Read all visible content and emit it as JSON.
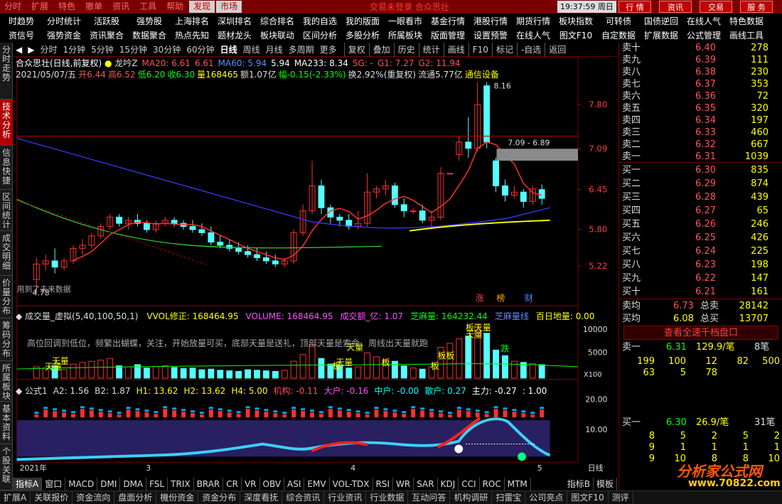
{
  "top_tabs": [
    "分时",
    "扩展",
    "特色",
    "撤单",
    "资讯",
    "工具",
    "帮助",
    "发现",
    "市场"
  ],
  "top_center": "交易未登录 合众思壮",
  "clock": "19:37:59 周日",
  "top_buttons": [
    "行 情",
    "资讯",
    "交易",
    "服 务"
  ],
  "menu_row1": [
    "时趋势",
    "分时统计",
    "活跃股",
    "强势股",
    "上海排名",
    "深圳排名",
    "综合排名",
    "我的自选",
    "我的版面",
    "一眼看市",
    "基金行情",
    "港股行情",
    "期货行情",
    "板块指数",
    "可转债",
    "国债逆回",
    "在线人气",
    "特色数据"
  ],
  "menu_row2": [
    "资信号",
    "强势资金",
    "资讯聚合",
    "数据聚合",
    "热点先知",
    "题材龙头",
    "板块联动",
    "区间分析",
    "多股分析",
    "所属板块",
    "版面管理",
    "设置预警",
    "在线人气",
    "图文F10",
    "自定数据",
    "扩展数据",
    "公式管理",
    "画线工具"
  ],
  "left_nav": [
    "分时走势",
    "技术分析",
    "信息快捷",
    "区间统计",
    "成交明细",
    "价量分布",
    "筹码分布",
    "所属板块",
    "基本资料",
    "个股关联"
  ],
  "periods": [
    "分时",
    "1分钟",
    "5分钟",
    "15分钟",
    "30分钟",
    "60分钟",
    "日线",
    "周线",
    "月线",
    "多周期",
    "更多"
  ],
  "period_active": "日线",
  "right_tools": [
    "复权",
    "叠加",
    "历史",
    "统计",
    "画线",
    "F10",
    "标记",
    "-自选",
    "返回"
  ],
  "stock_title": "合众思壮(日线,前复权)",
  "indicator_name": "龙吟Z",
  "ma": [
    {
      "label": "MA20: 6.61",
      "color": "#ff5050"
    },
    {
      "label": "6.61",
      "color": "#ff5050"
    },
    {
      "label": "MA60: 5.94",
      "color": "#5b8cff"
    },
    {
      "label": "5.94",
      "color": "#ffffff"
    },
    {
      "label": "MA233: 8.34",
      "color": "#ffffff"
    },
    {
      "label": "SG: -",
      "color": "#ff5050"
    },
    {
      "label": "G1: 7.27",
      "color": "#ff5050"
    },
    {
      "label": "G2: 11.94",
      "color": "#ff5050"
    }
  ],
  "day_info": [
    {
      "t": "2021/05/07/五",
      "c": "#dddddd"
    },
    {
      "t": "开6.44",
      "c": "#ff5050"
    },
    {
      "t": "高6.52",
      "c": "#ff5050"
    },
    {
      "t": "低6.20",
      "c": "#00ff00"
    },
    {
      "t": "收6.30",
      "c": "#00ff00"
    },
    {
      "t": "量168465",
      "c": "#ffff00"
    },
    {
      "t": "额1.07亿",
      "c": "#dddddd"
    },
    {
      "t": "幅-0.15(-2.33%)",
      "c": "#00ff00"
    },
    {
      "t": "换2.92%(重复权)",
      "c": "#dddddd"
    },
    {
      "t": "流通5.77亿",
      "c": "#dddddd"
    },
    {
      "t": "通信设备",
      "c": "#ffff00"
    }
  ],
  "price_axis": [
    "7.80",
    "7.09",
    "6.45",
    "5.80",
    "5.22"
  ],
  "annotations": {
    "high": "8.16",
    "low": "4.78",
    "band": "7.09 - 6.89",
    "used_data": "用到了未来数据",
    "badges": [
      "涨",
      "榜",
      "财"
    ]
  },
  "volume_panel": {
    "title": "成交量_虚拟(5,40,100,50,1)",
    "items": [
      {
        "t": "VVOL修正: 168464.95",
        "c": "#ffff00"
      },
      {
        "t": "VOLUME: 168464.95",
        "c": "#ff4fff"
      },
      {
        "t": "成交额_亿: 1.07",
        "c": "#ff4fff"
      },
      {
        "t": "芝麻量: 164232.44",
        "c": "#00ff00"
      },
      {
        "t": "芝麻量线",
        "c": "#5b8cff"
      },
      {
        "t": "百日地量: 0.00",
        "c": "#ffff00"
      }
    ],
    "hint": "高位回调到低位，频繁出蝴蝶，关注，开始放量可买，底部天量是送礼，顶部天量是索命，周线出天量就跑",
    "axis": [
      "10000",
      "5000"
    ],
    "unit": "X100",
    "labels": [
      "天量",
      "天量",
      "天量",
      "天量",
      "天量",
      "板",
      "板",
      "板",
      "板板",
      "板天量",
      "跌"
    ]
  },
  "formula_panel": {
    "title": "公式1",
    "items": [
      {
        "t": "A2: 1.56",
        "c": "#dddddd"
      },
      {
        "t": "B2: 1.87",
        "c": "#dddddd"
      },
      {
        "t": "H1: 13.62",
        "c": "#ffff00"
      },
      {
        "t": "H2: 13.62",
        "c": "#ffff00"
      },
      {
        "t": "H4: 5.00",
        "c": "#ffff00"
      },
      {
        "t": "机构: -0.11",
        "c": "#ff5050"
      },
      {
        "t": "大户: -0.16",
        "c": "#ff4fff"
      },
      {
        "t": "中户: -0.00",
        "c": "#00ffff"
      },
      {
        "t": "散户: 0.27",
        "c": "#00ffff"
      },
      {
        "t": "主力: -0.27",
        "c": "#ffffff"
      },
      {
        "t": ": 1.00",
        "c": "#ffffff"
      }
    ],
    "axis": [
      "20.00",
      "10.00"
    ]
  },
  "xaxis": {
    "year": "2021年",
    "m3": "3",
    "m4": "4",
    "m5": "5",
    "period": "日线"
  },
  "orderbook": {
    "asks": [
      {
        "l": "卖十",
        "p": "6.40",
        "v": "278"
      },
      {
        "l": "卖九",
        "p": "6.39",
        "v": "111"
      },
      {
        "l": "卖八",
        "p": "6.38",
        "v": "230"
      },
      {
        "l": "卖七",
        "p": "6.37",
        "v": "353"
      },
      {
        "l": "卖六",
        "p": "6.36",
        "v": "72"
      },
      {
        "l": "卖五",
        "p": "6.35",
        "v": "320"
      },
      {
        "l": "卖四",
        "p": "6.34",
        "v": "197"
      },
      {
        "l": "卖三",
        "p": "6.33",
        "v": "460"
      },
      {
        "l": "卖二",
        "p": "6.32",
        "v": "667"
      },
      {
        "l": "卖一",
        "p": "6.31",
        "v": "1039"
      }
    ],
    "bids": [
      {
        "l": "买一",
        "p": "6.30",
        "v": "835"
      },
      {
        "l": "买二",
        "p": "6.29",
        "v": "874"
      },
      {
        "l": "买三",
        "p": "6.28",
        "v": "439"
      },
      {
        "l": "买四",
        "p": "6.27",
        "v": "65"
      },
      {
        "l": "买五",
        "p": "6.26",
        "v": "246"
      },
      {
        "l": "买六",
        "p": "6.25",
        "v": "426"
      },
      {
        "l": "买七",
        "p": "6.24",
        "v": "225"
      },
      {
        "l": "买八",
        "p": "6.23",
        "v": "198"
      },
      {
        "l": "买九",
        "p": "6.22",
        "v": "147"
      },
      {
        "l": "买十",
        "p": "6.21",
        "v": "161"
      }
    ],
    "avg_sell": {
      "l": "卖均",
      "p": "6.73",
      "t": "总卖",
      "v": "28142"
    },
    "avg_buy": {
      "l": "买均",
      "p": "6.08",
      "t": "总买",
      "v": "13707"
    }
  },
  "full_book_btn": "查看全速千档盘口",
  "ask_queue": {
    "l": "卖一",
    "p": "6.31",
    "v": "129.9/笔",
    "n": "8笔",
    "q": [
      "199",
      "100",
      "12",
      "82",
      "500",
      "63",
      "5",
      "78"
    ]
  },
  "bid_queue": {
    "l": "买一",
    "p": "6.30",
    "v": "26.9/笔",
    "n": "31笔",
    "q": [
      "8",
      "5",
      "2",
      "5",
      "2",
      "9",
      "1",
      "1",
      "1",
      "1",
      "9",
      "10",
      "8",
      "8",
      "10"
    ]
  },
  "tabs": [
    "指标A",
    "窗口",
    "MACD",
    "DMI",
    "DMA",
    "FSL",
    "TRIX",
    "BRAR",
    "CR",
    "VR",
    "OBV",
    "ASI",
    "EMV",
    "VOL-TDX",
    "RSI",
    "WR",
    "SAR",
    "KDJ",
    "CCI",
    "ROC",
    "MTM"
  ],
  "tabs_right": [
    "指标B",
    "模板"
  ],
  "bottom_tabs": [
    "扩展A",
    "关联报价",
    "资金流向",
    "盘面分析",
    "機份资金",
    "资金分布",
    "深度看抚",
    "综合资讯",
    "行业资讯",
    "行业数据",
    "互动问答",
    "机构调研",
    "扫雷宝",
    "公司亮点",
    "图文F10",
    "测评"
  ],
  "watermark": "分析家公式网",
  "watermark_site": "www.70822.com",
  "colors": {
    "up": "#ff3030",
    "down": "#54ffff",
    "ma_short": "#ff3030",
    "ma_mid": "#33cc33",
    "ma_long": "#3a3aff",
    "ma_yellow": "#ffff00"
  }
}
